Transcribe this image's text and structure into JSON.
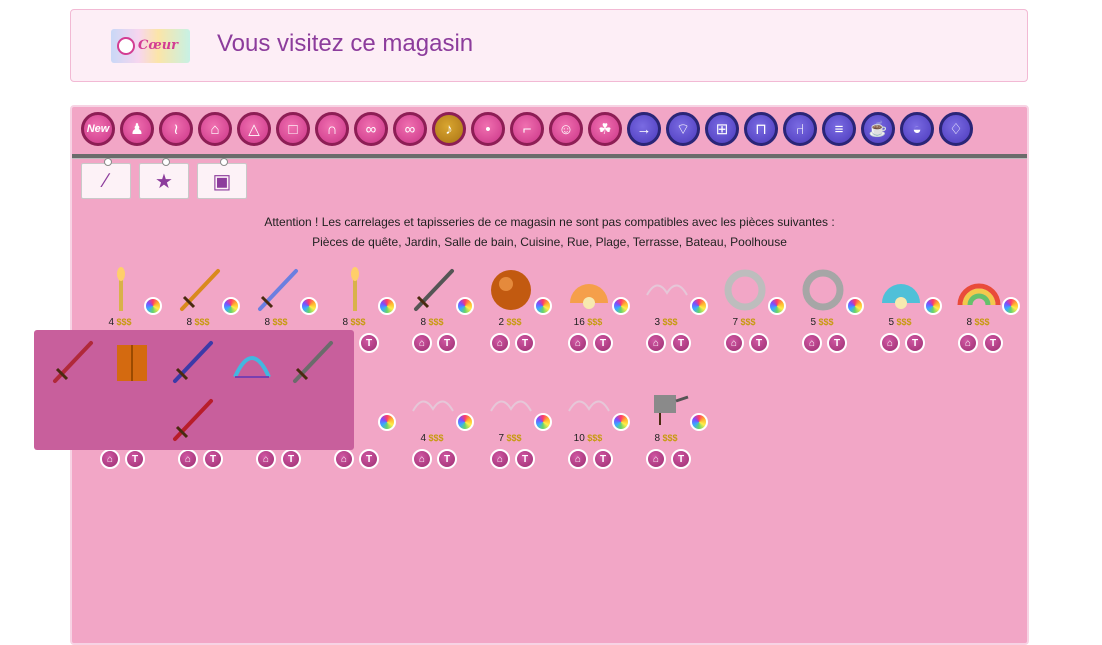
{
  "header": {
    "logo_text": "Cœur",
    "title": "Vous visitez ce magasin"
  },
  "categories": [
    {
      "name": "new",
      "label": "New",
      "icon": "new-badge-icon",
      "color": "pink"
    },
    {
      "name": "body",
      "label": "",
      "icon": "body-icon",
      "color": "pink"
    },
    {
      "name": "wig",
      "label": "",
      "icon": "wig-icon",
      "color": "pink"
    },
    {
      "name": "jacket",
      "label": "",
      "icon": "jacket-icon",
      "color": "pink"
    },
    {
      "name": "dress",
      "label": "",
      "icon": "dress-icon",
      "color": "pink"
    },
    {
      "name": "top",
      "label": "",
      "icon": "top-icon",
      "color": "pink"
    },
    {
      "name": "pants",
      "label": "",
      "icon": "pants-icon",
      "color": "pink"
    },
    {
      "name": "lingerie",
      "label": "",
      "icon": "lingerie-icon",
      "color": "pink"
    },
    {
      "name": "glasses",
      "label": "",
      "icon": "glasses-icon",
      "color": "pink"
    },
    {
      "name": "instrument",
      "label": "",
      "icon": "guitar-icon",
      "color": "active"
    },
    {
      "name": "jewelry",
      "label": "",
      "icon": "earrings-icon",
      "color": "pink"
    },
    {
      "name": "shoes",
      "label": "",
      "icon": "shoe-icon",
      "color": "pink"
    },
    {
      "name": "outfit",
      "label": "",
      "icon": "figure-icon",
      "color": "pink"
    },
    {
      "name": "pet",
      "label": "",
      "icon": "pet-icon",
      "color": "pink"
    },
    {
      "name": "wallpaper",
      "label": "",
      "icon": "paint-roller-icon",
      "color": "blue"
    },
    {
      "name": "tub",
      "label": "",
      "icon": "bathtub-icon",
      "color": "blue"
    },
    {
      "name": "window",
      "label": "",
      "icon": "window-icon",
      "color": "blue"
    },
    {
      "name": "table",
      "label": "",
      "icon": "table-icon",
      "color": "blue"
    },
    {
      "name": "chair",
      "label": "",
      "icon": "chair-icon",
      "color": "blue"
    },
    {
      "name": "dresser",
      "label": "",
      "icon": "dresser-icon",
      "color": "blue"
    },
    {
      "name": "teapot",
      "label": "",
      "icon": "teapot-icon",
      "color": "blue"
    },
    {
      "name": "pan",
      "label": "",
      "icon": "saucepan-icon",
      "color": "blue"
    },
    {
      "name": "vase",
      "label": "",
      "icon": "vase-icon",
      "color": "blue"
    }
  ],
  "subtabs": [
    {
      "name": "sword",
      "icon": "sword-icon"
    },
    {
      "name": "stars",
      "icon": "stars-icon"
    },
    {
      "name": "bag",
      "icon": "briefcase-icon"
    }
  ],
  "notice": {
    "line1": "Attention ! Les carrelages et tapisseries de ce magasin ne sont pas compatibles avec les pièces suivantes :",
    "line2": "Pièces de quête, Jardin, Salle de bain, Cuisine, Rue, Plage, Terrasse, Bateau, Poolhouse"
  },
  "currency": "$$$",
  "buy_label": "⌂",
  "try_label": "T",
  "row1": [
    {
      "price": "4",
      "icon": "candle-staff-icon",
      "color": "#f1d07a"
    },
    {
      "price": "8",
      "icon": "golden-sword-icon",
      "color": "#d98a1c"
    },
    {
      "price": "8",
      "icon": "blue-sword-icon",
      "color": "#6b7fe0"
    },
    {
      "price": "8",
      "icon": "candle-staff-icon",
      "color": "#f1d07a"
    },
    {
      "price": "8",
      "icon": "dark-sword-icon",
      "color": "#555555"
    },
    {
      "price": "2",
      "icon": "orange-orb-icon",
      "color": "#c25a10"
    },
    {
      "price": "16",
      "icon": "shell-icon",
      "color": "#f59f4a"
    },
    {
      "price": "3",
      "icon": "wings-icon",
      "color": "#e6c7d8"
    },
    {
      "price": "7",
      "icon": "wreath-icon",
      "color": "#bdbdbd"
    },
    {
      "price": "5",
      "icon": "ring-icon",
      "color": "#a6a6a6"
    },
    {
      "price": "5",
      "icon": "rainbow-shell-icon",
      "color": "#4fc0d8"
    },
    {
      "price": "8",
      "icon": "rainbow-icon",
      "color": "#f08b2a"
    }
  ],
  "row2": [
    {
      "price": "",
      "icon": "hidden-item-icon",
      "color": "#e9a0c4"
    },
    {
      "price": "",
      "icon": "hidden-item-icon",
      "color": "#e9a0c4"
    },
    {
      "price": "",
      "icon": "hidden-item-icon",
      "color": "#e9a0c4"
    },
    {
      "price": "",
      "icon": "hidden-item-icon",
      "color": "#e9a0c4"
    },
    {
      "price": "4",
      "icon": "wings-icon",
      "color": "#e6c7d8"
    },
    {
      "price": "7",
      "icon": "sparkle-line-icon",
      "color": "#e6c7d8"
    },
    {
      "price": "10",
      "icon": "lace-icon",
      "color": "#e6c7d8"
    },
    {
      "price": "8",
      "icon": "teapot-drip-icon",
      "color": "#555555"
    }
  ],
  "popup_items": [
    {
      "icon": "red-sword-icon",
      "color": "#b0293a"
    },
    {
      "icon": "orange-armor-icon",
      "color": "#d46a10"
    },
    {
      "icon": "blue-sword-icon",
      "color": "#3c3aa8"
    },
    {
      "icon": "bow-icon",
      "color": "#43b7e0"
    },
    {
      "icon": "dagger-icon",
      "color": "#6b6b6b"
    },
    {
      "icon": "red-blade-icon",
      "color": "#b81d2a"
    }
  ]
}
